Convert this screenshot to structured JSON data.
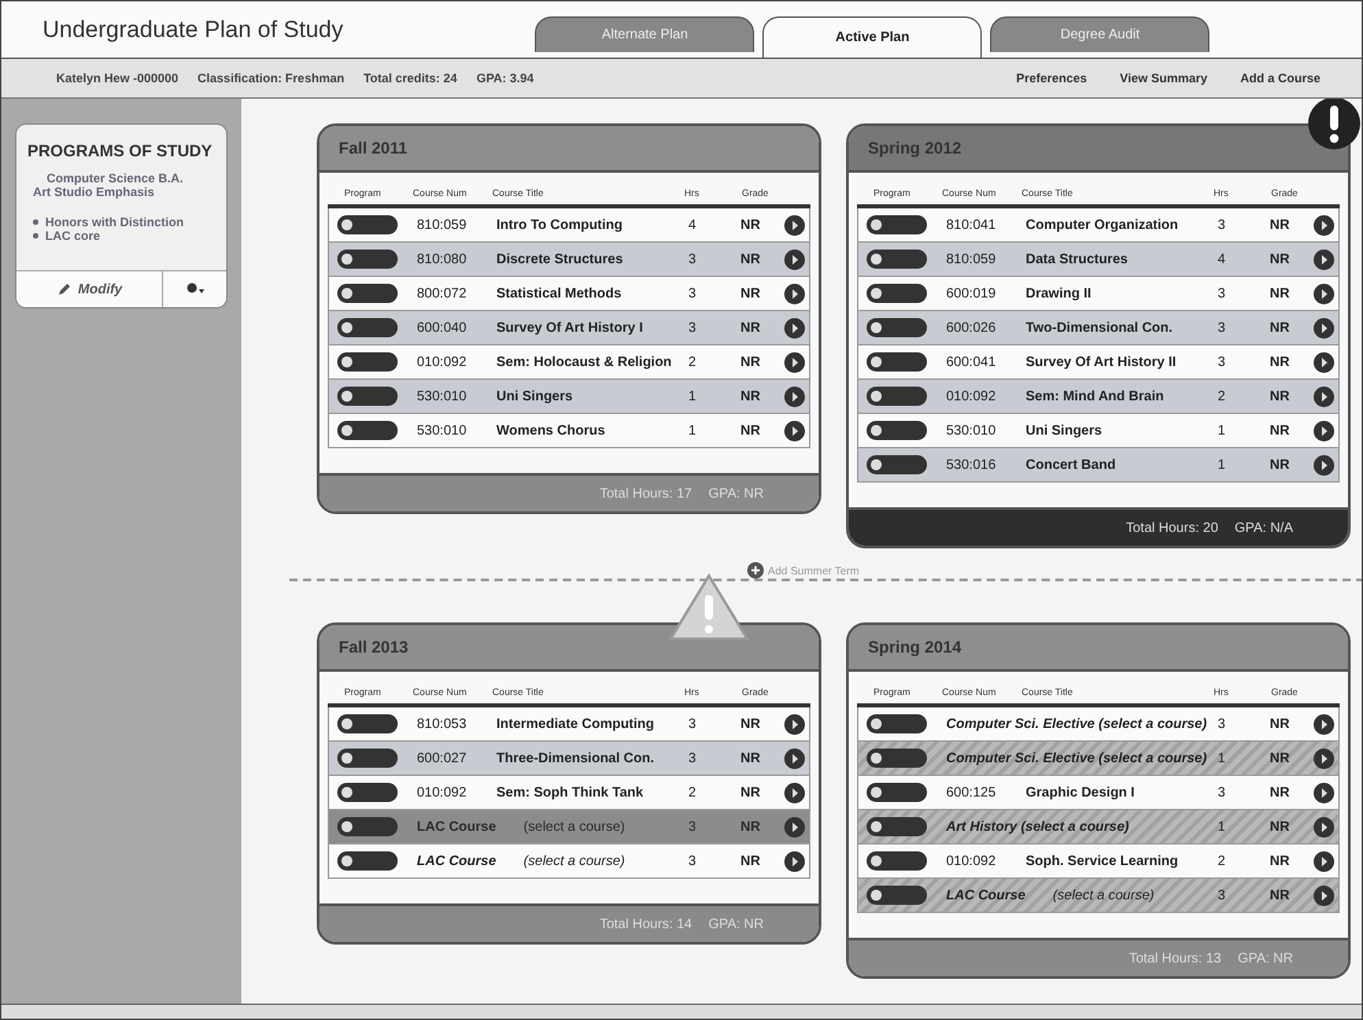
{
  "app_title": "Undergraduate Plan of Study",
  "tabs": [
    {
      "label": "Alternate Plan",
      "selected": false
    },
    {
      "label": "Active Plan",
      "selected": true
    },
    {
      "label": "Degree Audit",
      "selected": false
    }
  ],
  "student": {
    "name": "Katelyn Hew",
    "id": "-000000",
    "classification": "Classification: Freshman",
    "credits": "Total credits: 24",
    "gpa": "GPA: 3.94"
  },
  "links": [
    "Preferences",
    "View Summary",
    "Add a Course"
  ],
  "sidebar": {
    "title": "PROGRAMS OF STUDY",
    "major": "Computer Science B.A.",
    "emphasis": "Art Studio Emphasis",
    "programs": [
      "Honors with Distinction",
      "LAC core"
    ],
    "modify": "Modify"
  },
  "add_term": "Add Summer Term",
  "terms": [
    {
      "name": "Fall 2011",
      "kind": "normal",
      "hatched": false,
      "columns": [
        "Program",
        "Course Num",
        "Course Title",
        "Hrs",
        "Grade"
      ],
      "total": "Total Hours: 17",
      "gpa": "GPA: NR",
      "rows": [
        {
          "kind": "course",
          "num": "810:059",
          "title": "Intro To Computing",
          "hrs": "4",
          "grade": "NR"
        },
        {
          "kind": "course",
          "num": "810:080",
          "title": "Discrete Structures",
          "hrs": "3",
          "grade": "NR"
        },
        {
          "kind": "course",
          "num": "800:072",
          "title": "Statistical Methods",
          "hrs": "3",
          "grade": "NR"
        },
        {
          "kind": "course",
          "num": "600:040",
          "title": "Survey Of Art History I",
          "hrs": "3",
          "grade": "NR"
        },
        {
          "kind": "course",
          "num": "010:092",
          "title": "Sem: Holocaust & Religion",
          "hrs": "2",
          "grade": "NR"
        },
        {
          "kind": "course",
          "num": "530:010",
          "title": "Uni Singers",
          "hrs": "1",
          "grade": "NR"
        },
        {
          "kind": "course",
          "num": "530:010",
          "title": "Womens Chorus",
          "hrs": "1",
          "grade": "NR"
        }
      ]
    },
    {
      "name": "Spring 2012",
      "kind": "error",
      "hatched": false,
      "columns": [
        "Program",
        "Course Num",
        "Course Title",
        "Hrs",
        "Grade"
      ],
      "total": "Total Hours: 20",
      "gpa": "GPA: N/A",
      "rows": [
        {
          "kind": "course",
          "num": "810:041",
          "title": "Computer Organization",
          "hrs": "3",
          "grade": "NR"
        },
        {
          "kind": "course",
          "num": "810:059",
          "title": "Data Structures",
          "hrs": "4",
          "grade": "NR"
        },
        {
          "kind": "course",
          "num": "600:019",
          "title": "Drawing II",
          "hrs": "3",
          "grade": "NR"
        },
        {
          "kind": "course",
          "num": "600:026",
          "title": "Two-Dimensional Con.",
          "hrs": "3",
          "grade": "NR"
        },
        {
          "kind": "course",
          "num": "600:041",
          "title": "Survey Of Art History II",
          "hrs": "3",
          "grade": "NR"
        },
        {
          "kind": "course",
          "num": "010:092",
          "title": "Sem: Mind And Brain",
          "hrs": "2",
          "grade": "NR"
        },
        {
          "kind": "course",
          "num": "530:010",
          "title": "Uni Singers",
          "hrs": "1",
          "grade": "NR"
        },
        {
          "kind": "course",
          "num": "530:016",
          "title": "Concert Band",
          "hrs": "1",
          "grade": "NR"
        }
      ]
    },
    {
      "name": "Fall 2013",
      "kind": "warning",
      "hatched": false,
      "columns": [
        "Program",
        "Course Num",
        "Course Title",
        "Hrs",
        "Grade"
      ],
      "total": "Total Hours: 14",
      "gpa": "GPA: NR",
      "rows": [
        {
          "kind": "course",
          "num": "810:053",
          "title": "Intermediate Computing",
          "hrs": "3",
          "grade": "NR"
        },
        {
          "kind": "course",
          "num": "600:027",
          "title": "Three-Dimensional Con.",
          "hrs": "3",
          "grade": "NR"
        },
        {
          "kind": "course",
          "num": "010:092",
          "title": "Sem: Soph Think Tank",
          "hrs": "2",
          "grade": "NR"
        },
        {
          "kind": "dimmed",
          "title": "LAC Course",
          "note": "(select a course)",
          "hrs": "3",
          "grade": "NR"
        },
        {
          "kind": "requirement",
          "title": "LAC Course",
          "note": "(select a course)",
          "hrs": "3",
          "grade": "NR"
        }
      ]
    },
    {
      "name": "Spring 2014",
      "kind": "normal",
      "hatched": true,
      "columns": [
        "Program",
        "Course Num",
        "Course Title",
        "Hrs",
        "Grade"
      ],
      "total": "Total Hours: 13",
      "gpa": "GPA: NR",
      "rows": [
        {
          "kind": "requirement",
          "title": "Computer Sci. Elective (select a course)",
          "hrs": "3",
          "grade": "NR"
        },
        {
          "kind": "requirement",
          "title": "Computer Sci. Elective (select a course)",
          "hrs": "1",
          "grade": "NR"
        },
        {
          "kind": "course",
          "num": "600:125",
          "title": "Graphic Design I",
          "hrs": "3",
          "grade": "NR"
        },
        {
          "kind": "requirement",
          "title": "Art History (select a course)",
          "hrs": "1",
          "grade": "NR"
        },
        {
          "kind": "course",
          "num": "010:092",
          "title": "Soph. Service Learning",
          "hrs": "2",
          "grade": "NR"
        },
        {
          "kind": "requirement",
          "title": "LAC Course",
          "note": "(select a course)",
          "hrs": "3",
          "grade": "NR"
        }
      ]
    }
  ]
}
